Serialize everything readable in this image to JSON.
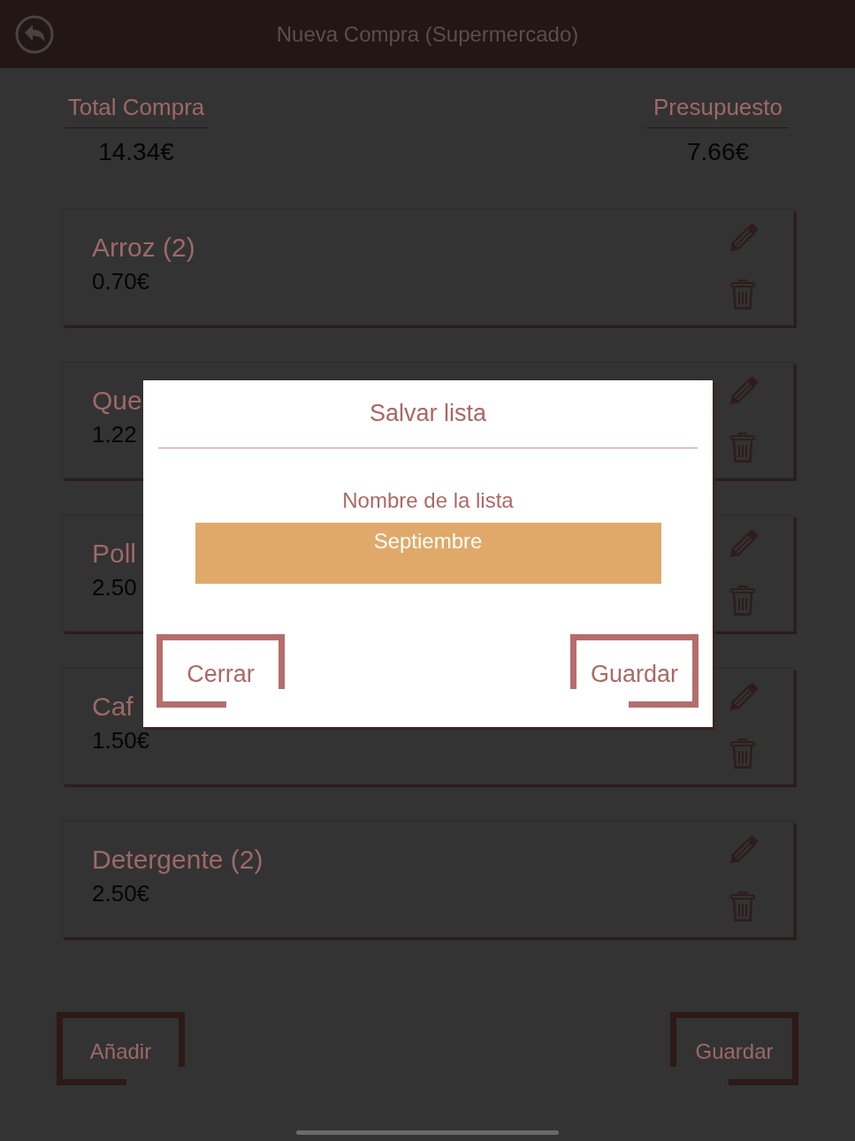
{
  "header": {
    "title": "Nueva Compra (Supermercado)"
  },
  "totals": [
    {
      "label": "Total Compra",
      "value": "14.34€"
    },
    {
      "label": "Presupuesto",
      "value": "7.66€"
    }
  ],
  "items": [
    {
      "name": "Arroz (2)",
      "price": "0.70€"
    },
    {
      "name": "Que",
      "price": "1.22"
    },
    {
      "name": "Poll",
      "price": "2.50"
    },
    {
      "name": "Caf",
      "price": "1.50€"
    },
    {
      "name": "Detergente (2)",
      "price": "2.50€"
    }
  ],
  "footer_buttons": [
    "Añadir",
    "Guardar"
  ],
  "dialog": {
    "title": "Salvar lista",
    "field_label": "Nombre de la lista",
    "field_value": "Septiembre",
    "buttons": [
      "Cerrar",
      "Guardar"
    ]
  }
}
